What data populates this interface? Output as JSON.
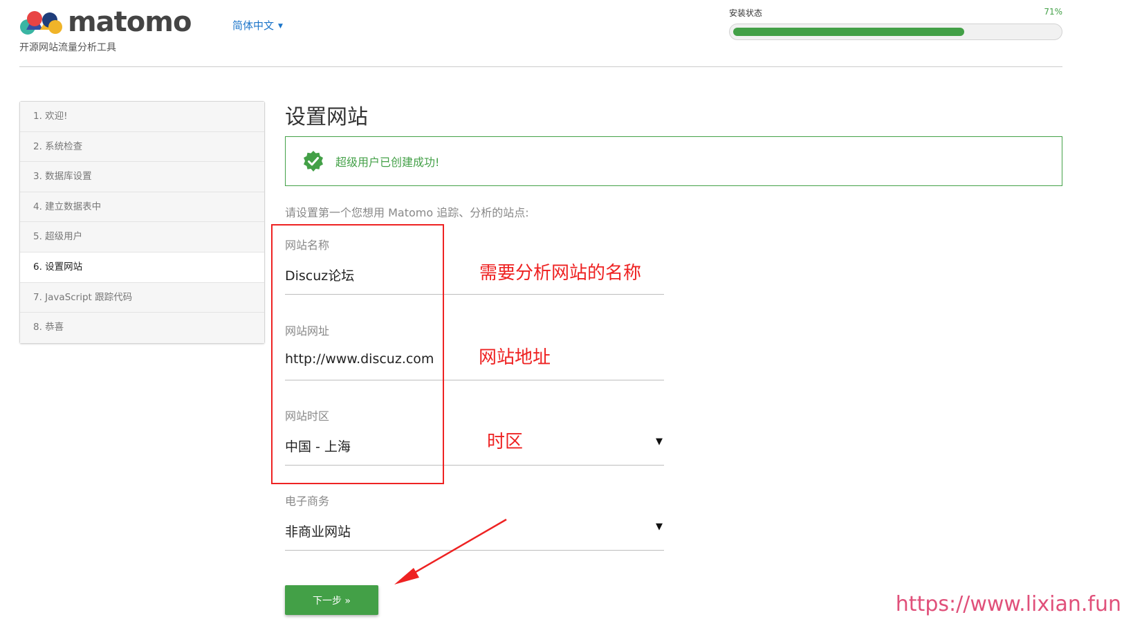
{
  "header": {
    "logo_text": "matomo",
    "tagline": "开源网站流量分析工具",
    "language": "简体中文",
    "install_status": {
      "label": "安装状态",
      "percent_text": "71%",
      "progress_fraction": 0.71
    }
  },
  "steps": [
    {
      "label": "1. 欢迎!",
      "active": false
    },
    {
      "label": "2. 系统检查",
      "active": false
    },
    {
      "label": "3. 数据库设置",
      "active": false
    },
    {
      "label": "4. 建立数据表中",
      "active": false
    },
    {
      "label": "5. 超级用户",
      "active": false
    },
    {
      "label": "6. 设置网站",
      "active": true
    },
    {
      "label": "7. JavaScript 跟踪代码",
      "active": false
    },
    {
      "label": "8. 恭喜",
      "active": false
    }
  ],
  "main": {
    "title": "设置网站",
    "success_message": "超级用户已创建成功!",
    "intro": "请设置第一个您想用 Matomo 追踪、分析的站点:",
    "fields": {
      "site_name": {
        "label": "网站名称",
        "value": "Discuz论坛"
      },
      "site_url": {
        "label": "网站网址",
        "value": "http://www.discuz.com"
      },
      "timezone": {
        "label": "网站时区",
        "value": "中国 - 上海"
      },
      "ecommerce": {
        "label": "电子商务",
        "value": "非商业网站"
      }
    },
    "next_button": "下一步 »"
  },
  "annotations": {
    "name_note": "需要分析网站的名称",
    "url_note": "网站地址",
    "timezone_note": "时区",
    "watermark": "https://www.lixian.fun"
  },
  "colors": {
    "accent_green": "#43a047",
    "link_blue": "#1a74c9",
    "annotation_red": "#ee2222",
    "watermark_pink": "#e0507a"
  }
}
